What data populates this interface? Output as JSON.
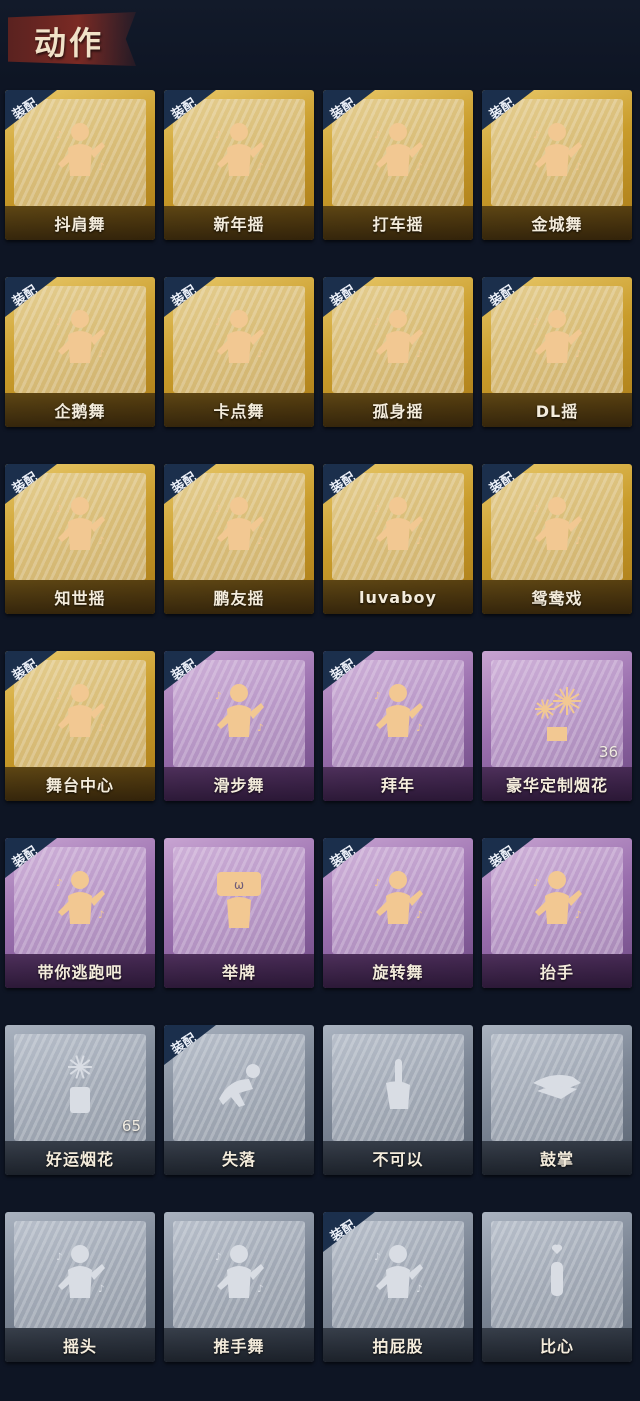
{
  "header": {
    "title": "动作"
  },
  "badges": {
    "equip": "装配"
  },
  "items": [
    {
      "label": "抖肩舞",
      "rarity": "gold",
      "equipped": true,
      "icon": "dancer-icon"
    },
    {
      "label": "新年摇",
      "rarity": "gold",
      "equipped": true,
      "icon": "dancer-icon"
    },
    {
      "label": "打车摇",
      "rarity": "gold",
      "equipped": true,
      "icon": "dancer-icon"
    },
    {
      "label": "金城舞",
      "rarity": "gold",
      "equipped": true,
      "icon": "dancer-icon"
    },
    {
      "label": "企鹅舞",
      "rarity": "gold",
      "equipped": true,
      "icon": "dancer-icon"
    },
    {
      "label": "卡点舞",
      "rarity": "gold",
      "equipped": true,
      "icon": "dancer-icon"
    },
    {
      "label": "孤身摇",
      "rarity": "gold",
      "equipped": true,
      "icon": "dancer-icon"
    },
    {
      "label": "DL摇",
      "rarity": "gold",
      "equipped": true,
      "icon": "dancer-icon"
    },
    {
      "label": "知世摇",
      "rarity": "gold",
      "equipped": true,
      "icon": "dancer-icon"
    },
    {
      "label": "鹏友摇",
      "rarity": "gold",
      "equipped": true,
      "icon": "dancer-icon"
    },
    {
      "label": "luvaboy",
      "rarity": "gold",
      "equipped": true,
      "icon": "dancer-icon"
    },
    {
      "label": "鸳鸯戏",
      "rarity": "gold",
      "equipped": true,
      "icon": "dancer-icon"
    },
    {
      "label": "舞台中心",
      "rarity": "gold",
      "equipped": true,
      "icon": "dancer-icon"
    },
    {
      "label": "滑步舞",
      "rarity": "purple",
      "equipped": true,
      "icon": "dancer-icon"
    },
    {
      "label": "拜年",
      "rarity": "purple",
      "equipped": true,
      "icon": "bow-icon"
    },
    {
      "label": "豪华定制烟花",
      "rarity": "purple",
      "equipped": false,
      "icon": "fireworks-icon",
      "count": "36"
    },
    {
      "label": "带你逃跑吧",
      "rarity": "purple",
      "equipped": true,
      "icon": "dancer-icon"
    },
    {
      "label": "举牌",
      "rarity": "purple",
      "equipped": false,
      "icon": "sign-icon"
    },
    {
      "label": "旋转舞",
      "rarity": "purple",
      "equipped": true,
      "icon": "spin-icon"
    },
    {
      "label": "抬手",
      "rarity": "purple",
      "equipped": true,
      "icon": "raise-hand-icon"
    },
    {
      "label": "好运烟花",
      "rarity": "grey",
      "equipped": false,
      "icon": "firework-can-icon",
      "count": "65"
    },
    {
      "label": "失落",
      "rarity": "grey",
      "equipped": true,
      "icon": "crawl-icon"
    },
    {
      "label": "不可以",
      "rarity": "grey",
      "equipped": false,
      "icon": "finger-wag-icon"
    },
    {
      "label": "鼓掌",
      "rarity": "grey",
      "equipped": false,
      "icon": "clap-icon"
    },
    {
      "label": "摇头",
      "rarity": "grey",
      "equipped": false,
      "icon": "head-shake-icon"
    },
    {
      "label": "推手舞",
      "rarity": "grey",
      "equipped": false,
      "icon": "push-hands-icon"
    },
    {
      "label": "拍屁股",
      "rarity": "grey",
      "equipped": true,
      "icon": "slap-icon"
    },
    {
      "label": "比心",
      "rarity": "grey",
      "equipped": false,
      "icon": "heart-hand-icon"
    }
  ],
  "colors": {
    "gold_icon": "#f2c892",
    "purple_icon": "#f2c892",
    "grey_icon": "#d9dde4",
    "equip_badge": "#1b2f4c"
  }
}
